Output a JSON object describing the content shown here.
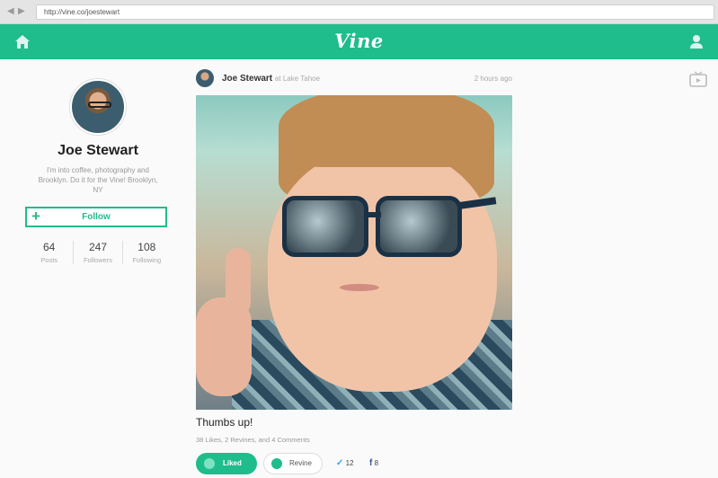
{
  "browser": {
    "url": "http://vine.co/joestewart"
  },
  "header": {
    "logo": "Vine",
    "icons": [
      "home-icon",
      "user-icon"
    ]
  },
  "profile": {
    "name": "Joe Stewart",
    "bio": "I'm into coffee, photography and Brooklyn. Do it for the Vine! Brooklyn, NY",
    "follow_label": "Follow",
    "stats": [
      {
        "value": "64",
        "label": "Posts"
      },
      {
        "value": "247",
        "label": "Followers"
      },
      {
        "value": "108",
        "label": "Following"
      }
    ]
  },
  "post": {
    "author": "Joe Stewart",
    "location": "at Lake Tahoe",
    "time": "2 hours ago",
    "caption": "Thumbs up!",
    "counts": "38 Likes, 2 Revines, and 4 Comments",
    "liked_label": "Liked",
    "revine_label": "Revine",
    "twitter_count": "12",
    "facebook_count": "8"
  },
  "colors": {
    "brand": "#1fbc8c"
  },
  "side_icons": [
    "tv-icon"
  ]
}
